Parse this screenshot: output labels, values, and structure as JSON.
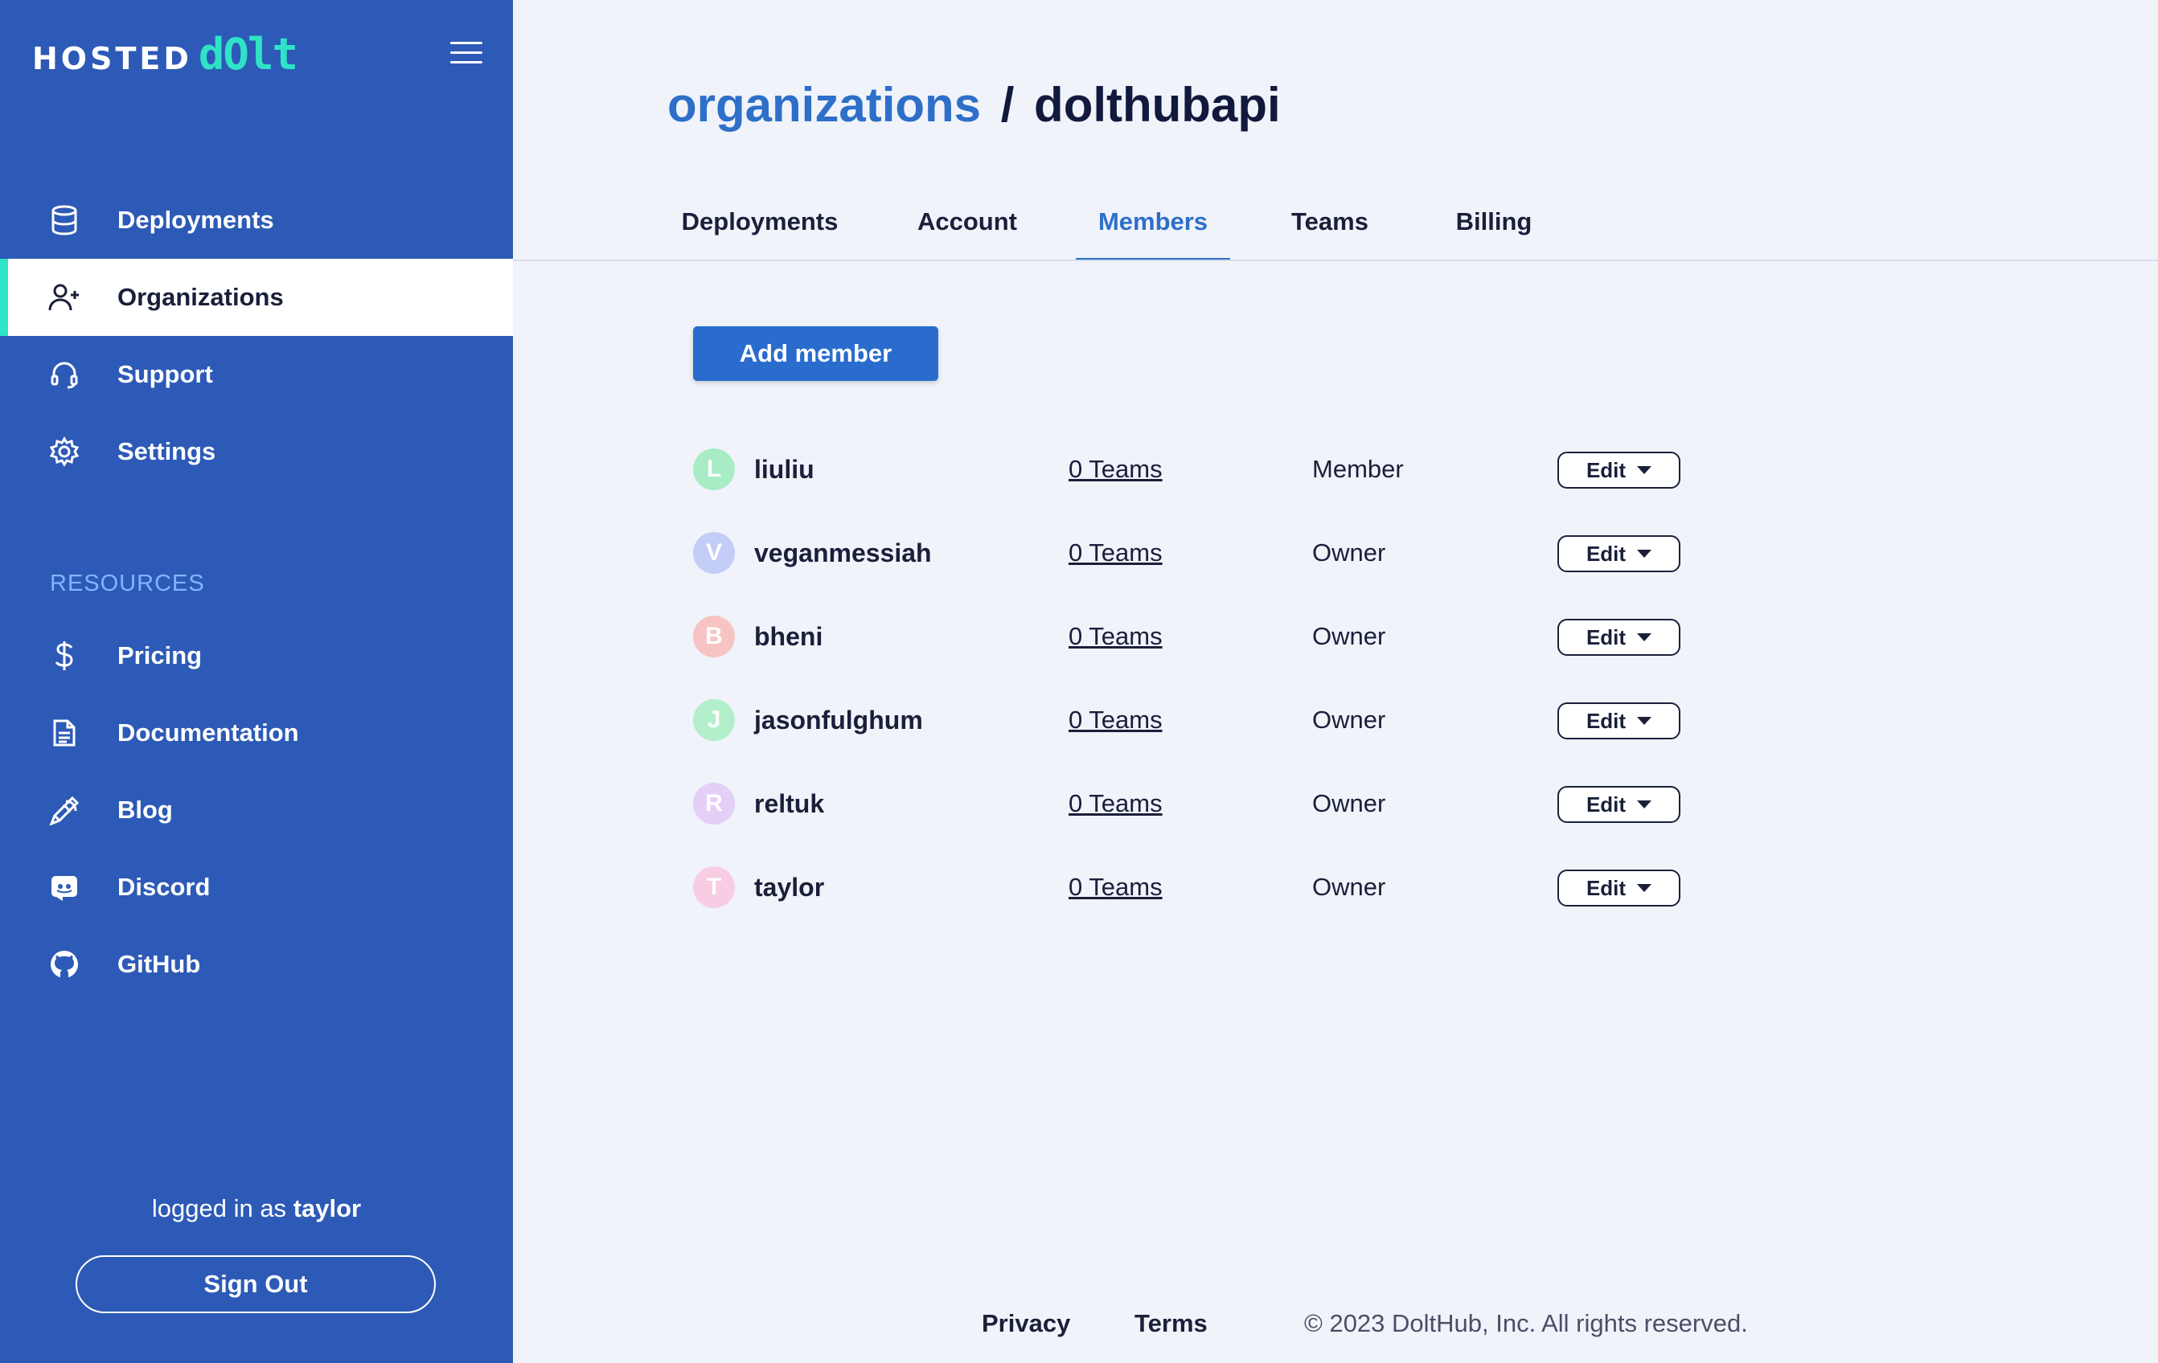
{
  "app": {
    "logo_hosted": "HOSTED",
    "logo_dolt": "dOlt"
  },
  "sidebar": {
    "nav": [
      {
        "label": "Deployments",
        "icon": "database-icon"
      },
      {
        "label": "Organizations",
        "icon": "user-plus-icon",
        "active": true
      },
      {
        "label": "Support",
        "icon": "headset-icon"
      },
      {
        "label": "Settings",
        "icon": "gear-icon"
      }
    ],
    "resources_title": "RESOURCES",
    "resources": [
      {
        "label": "Pricing",
        "icon": "dollar-icon"
      },
      {
        "label": "Documentation",
        "icon": "document-icon"
      },
      {
        "label": "Blog",
        "icon": "pen-icon"
      },
      {
        "label": "Discord",
        "icon": "discord-icon"
      },
      {
        "label": "GitHub",
        "icon": "github-icon"
      }
    ],
    "logged_in_prefix": "logged in as",
    "logged_in_user": "taylor",
    "sign_out": "Sign Out"
  },
  "breadcrumb": {
    "link": "organizations",
    "separator": "/",
    "current": "dolthubapi"
  },
  "tabs": [
    {
      "label": "Deployments"
    },
    {
      "label": "Account"
    },
    {
      "label": "Members",
      "active": true
    },
    {
      "label": "Teams"
    },
    {
      "label": "Billing"
    }
  ],
  "add_member": "Add member",
  "members": [
    {
      "initial": "L",
      "name": "liuliu",
      "teams": "0 Teams",
      "role": "Member",
      "edit": "Edit",
      "avatar_color": "#a8ecc6"
    },
    {
      "initial": "V",
      "name": "veganmessiah",
      "teams": "0 Teams",
      "role": "Owner",
      "edit": "Edit",
      "avatar_color": "#c3cdf7"
    },
    {
      "initial": "B",
      "name": "bheni",
      "teams": "0 Teams",
      "role": "Owner",
      "edit": "Edit",
      "avatar_color": "#f8c3c3"
    },
    {
      "initial": "J",
      "name": "jasonfulghum",
      "teams": "0 Teams",
      "role": "Owner",
      "edit": "Edit",
      "avatar_color": "#b4efcc"
    },
    {
      "initial": "R",
      "name": "reltuk",
      "teams": "0 Teams",
      "role": "Owner",
      "edit": "Edit",
      "avatar_color": "#e4cff7"
    },
    {
      "initial": "T",
      "name": "taylor",
      "teams": "0 Teams",
      "role": "Owner",
      "edit": "Edit",
      "avatar_color": "#f8cde3"
    }
  ],
  "footer": {
    "privacy": "Privacy",
    "terms": "Terms",
    "copyright": "© 2023 DoltHub, Inc. All rights reserved."
  },
  "colors": {
    "sidebar_bg": "#2d5ab6",
    "accent": "#2fe3c7",
    "primary": "#2d6fc9",
    "page_bg": "#f0f3fa"
  }
}
